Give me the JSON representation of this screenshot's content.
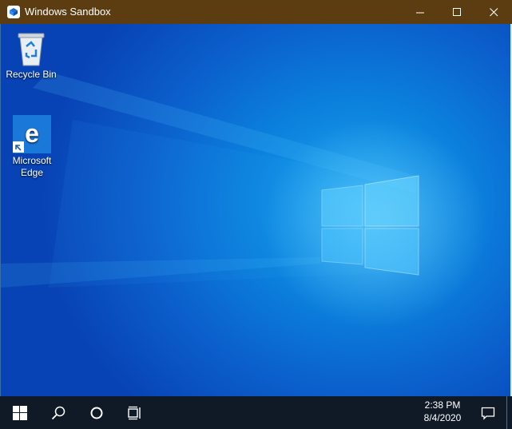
{
  "window": {
    "title": "Windows Sandbox",
    "titlebar_color": "#5c3d11"
  },
  "controls": {
    "minimize": "minimize-icon",
    "maximize": "maximize-icon",
    "close": "close-icon"
  },
  "desktop": {
    "icons": [
      {
        "label": "Recycle Bin",
        "icon": "recycle-bin-icon"
      },
      {
        "label": "Microsoft Edge",
        "icon": "edge-icon"
      }
    ],
    "accent": "#0b7fdc"
  },
  "taskbar": {
    "buttons": [
      "start-icon",
      "search-icon",
      "cortana-icon",
      "task-view-icon"
    ],
    "time": "2:38 PM",
    "date": "8/4/2020",
    "notification": "action-center-icon"
  }
}
